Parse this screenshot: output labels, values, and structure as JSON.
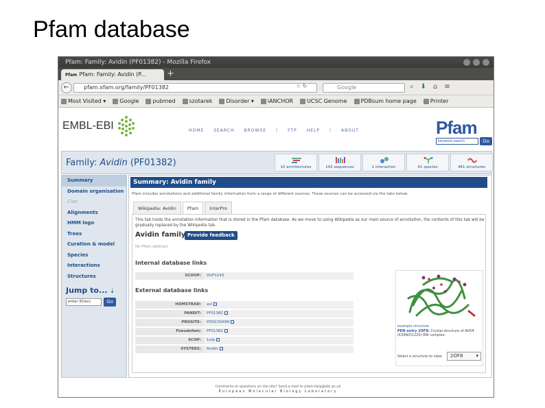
{
  "slide": {
    "title": "Pfam database"
  },
  "window": {
    "title": "Pfam: Family: Avidin (PF01382) - Mozilla Firefox"
  },
  "tabs": [
    {
      "label": "Pfam: Family: Avidin (P...",
      "favicon": "Pfam"
    }
  ],
  "navbar": {
    "url": "pfam.xfam.org/family/PF01382",
    "search_placeholder": "Google",
    "search_engine_icon": "G"
  },
  "bookmarks": [
    "Most Visited ▾",
    "Google",
    "pubmed",
    "szotarek",
    "Disorder ▾",
    "iANCHOR",
    "UCSC Genome",
    "PDBsum home page",
    "Printer"
  ],
  "header": {
    "ebi_logo": "EMBL-EBI",
    "nav": [
      "HOME",
      "SEARCH",
      "BROWSE",
      "FTP",
      "HELP",
      "ABOUT"
    ],
    "pfam_logo": "Pfam",
    "keyword_placeholder": "keyword search",
    "go_label": "Go"
  },
  "family": {
    "title_prefix": "Family: ",
    "title_name": "Avidin",
    "title_acc": " (PF01382)",
    "stats": [
      "10 architectures",
      "142 sequences",
      "1 interaction",
      "41 species",
      "461 structures"
    ]
  },
  "sidebar": {
    "items": [
      "Summary",
      "Domain organisation",
      "Clan",
      "Alignments",
      "HMM logo",
      "Trees",
      "Curation & model",
      "Species",
      "Interactions",
      "Structures"
    ],
    "jump_label": "Jump to...",
    "jump_placeholder": "enter ID/acc",
    "jump_go": "Go"
  },
  "main": {
    "summary_title": "Summary: Avidin family",
    "intro": "Pfam includes annotations and additional family information from a range of different sources. These sources can be accessed via the tabs below.",
    "tabs": [
      "Wikipedia: Avidin",
      "Pfam",
      "InterPro"
    ],
    "panel_note": "This tab holds the annotation information that is stored in the Pfam database. As we move to using Wikipedia as our main source of annotation, the contents of this tab will be gradually replaced by the Wikipedia tab.",
    "family_heading": "Avidin family",
    "feedback_label": "Provide feedback",
    "no_annotation": "No Pfam abstract.",
    "internal_heading": "Internal database links",
    "internal_links": [
      {
        "key": "SCOOP:",
        "value": "DUF1143"
      }
    ],
    "external_heading": "External database links",
    "external_links": [
      {
        "key": "HOMSTRAD:",
        "value": "avi"
      },
      {
        "key": "PANDIT:",
        "value": "PF01382"
      },
      {
        "key": "PROSITE:",
        "value": "PDOC00499"
      },
      {
        "key": "Pseudofam:",
        "value": "PF01382"
      },
      {
        "key": "SCOP:",
        "value": "1stp"
      },
      {
        "key": "SYSTERS:",
        "value": "Avidin"
      }
    ]
  },
  "structure": {
    "caption_link": "example structure",
    "caption_pdb": "PDB entry 2OF8:",
    "caption_text": " Crystal structure of AVD4 (K39N/D122S) BNI complex.",
    "select_label": "Select a structure to view:",
    "select_value": "2OF8"
  },
  "footer": {
    "line1": "Comments or questions on the site? Send a mail to pfam-help@ebi.ac.uk",
    "line2": "European Molecular Biology Laboratory"
  },
  "colors": {
    "pfam_blue": "#1f4d8a",
    "panel_bg": "#dfe6ee",
    "link": "#2d5aa0"
  }
}
